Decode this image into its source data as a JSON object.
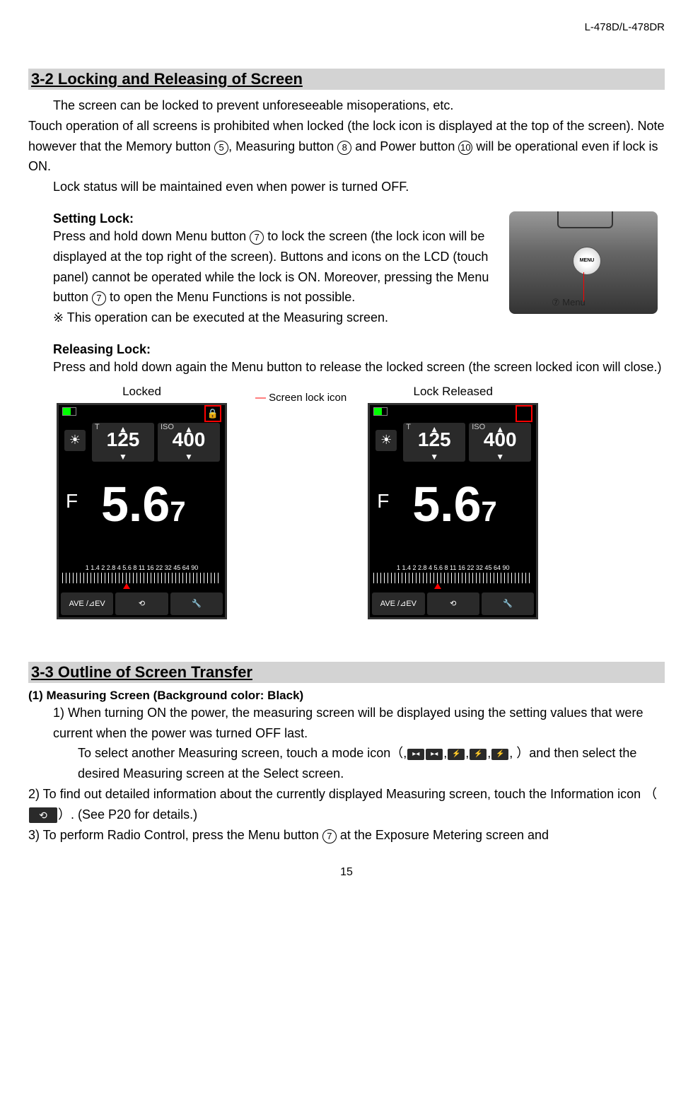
{
  "header": {
    "model": "L-478D/L-478DR"
  },
  "s32": {
    "title": "3-2 Locking and Releasing of Screen",
    "p1": "The screen can be locked to prevent unforeseeable misoperations, etc.",
    "p2a": "Touch operation of all screens is prohibited when locked (the lock icon is displayed at the top of the screen). Note however that the Memory button ",
    "p2b": ", Measuring button ",
    "p2c": " and Power button ",
    "p2d": " will be operational even if lock is ON.",
    "c5": "5",
    "c8": "8",
    "c10": "10",
    "p3": "Lock status will be maintained even when power is turned OFF.",
    "setLock": "Setting Lock:",
    "sl1a": "Press and hold down Menu button ",
    "sl1b": " to lock the screen (the lock icon will be displayed at the top right of the screen). Buttons and icons on the LCD (touch panel) cannot be operated while the lock is ON. Moreover, pressing the Menu button ",
    "sl1c": " to open the Menu Functions is not possible.",
    "c7": "7",
    "note": "※  This operation can be executed at the Measuring screen.",
    "relLock": "Releasing Lock:",
    "rl1": "Press and hold down again the Menu button to release the locked screen (the screen locked icon will close.)",
    "capLocked": "Locked",
    "capReleased": "Lock Released",
    "annotation": "Screen lock icon",
    "menuLabel": "⑦ Menu"
  },
  "lcd": {
    "t_label": "T",
    "iso_label": "ISO",
    "t_value": "125",
    "iso_value": "400",
    "f_label": "F",
    "f_value": "5.6",
    "f_sub": "7",
    "scale": "1 1.4 2 2.8 4 5.6 8 11 16 22 32 45 64 90",
    "btn1": "AVE /⊿EV",
    "btn2": "⟲",
    "btn3": "🔧"
  },
  "s33": {
    "title": "3-3 Outline of Screen Transfer",
    "sub1": "(1) Measuring Screen (Background color: Black)",
    "b1": "1) When turning ON the power, the measuring screen will be displayed using the setting values that were current when the power was turned OFF last.",
    "b1sub_a": "To select another Measuring screen, touch a mode icon（,",
    "b1sub_b": ",",
    "b1sub_c": ",",
    "b1sub_d": ",",
    "b1sub_e": ",   ）and then select the desired Measuring screen at the Select screen.",
    "b2a": "2) To find out detailed information about the currently displayed Measuring screen, touch the Information icon （",
    "b2b": "）. (See P20 for details.)",
    "b3a": "3) To perform Radio Control, press the Menu button ",
    "b3b": " at the Exposure Metering screen and",
    "infoIcon": "⟲"
  },
  "pageNum": "15"
}
